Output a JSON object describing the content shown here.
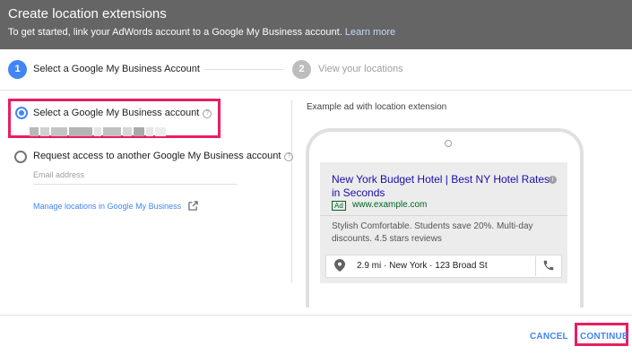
{
  "header": {
    "title": "Create location extensions",
    "subtitle": "To get started, link your AdWords account to a Google My Business account.",
    "learn_more": "Learn more",
    "bg_color": "#656565"
  },
  "stepper": {
    "steps": [
      {
        "number": "1",
        "label": "Select a Google My Business Account",
        "state": "active"
      },
      {
        "number": "2",
        "label": "View your locations",
        "state": "inactive"
      }
    ]
  },
  "options": {
    "select_account": {
      "label": "Select a Google My Business account",
      "selected": true
    },
    "request_access": {
      "label": "Request access to another Google My Business account",
      "selected": false
    },
    "email_placeholder": "Email address",
    "help_icon": "?"
  },
  "manage_link": {
    "label": "Manage locations in Google My Business",
    "icon": "external-link-icon"
  },
  "example": {
    "heading": "Example ad with location extension",
    "ad": {
      "title": "New York Budget Hotel | Best NY Hotel Rates in Seconds",
      "badge": "Ad",
      "url": "www.example.com",
      "description": "Stylish Comfortable. Students save 20%. Multi-day discounts. 4.5 stars reviews",
      "location": "2.9 mi · New York · 123 Broad St",
      "info_icon": "i"
    }
  },
  "footer": {
    "cancel": "CANCEL",
    "continue": "CONTINUE"
  },
  "colors": {
    "accent": "#4285f4",
    "highlight": "#e91e63",
    "ad_link": "#1a0dab",
    "ad_url": "#006621"
  }
}
